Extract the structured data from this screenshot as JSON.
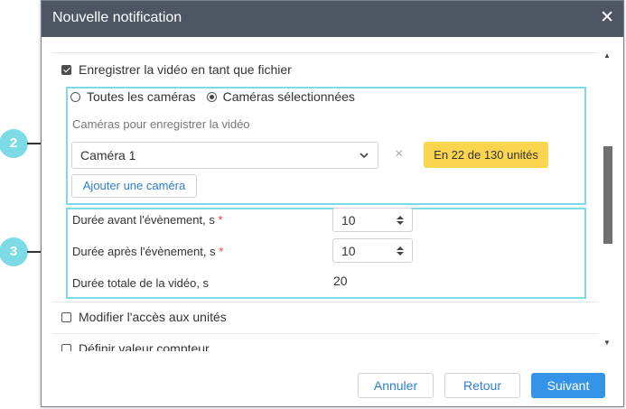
{
  "dialog": {
    "title": "Nouvelle notification",
    "close_glyph": "✕"
  },
  "record_video": {
    "label": "Enregistrer la vidéo en tant que fichier",
    "checked": true
  },
  "camera_mode": {
    "all_label": "Toutes les caméras",
    "selected_label": "Caméras sélectionnées",
    "selected": "selected"
  },
  "cameras": {
    "section_label": "Caméras pour enregistrer la vidéo",
    "selected_value": "Caméra 1",
    "clear_glyph": "×",
    "badge": "En 22 de 130 unités",
    "add_button": "Ajouter une caméra"
  },
  "fields": {
    "before_label": "Durée avant l'évènement, s",
    "before_value": "10",
    "after_label": "Durée après l'évènement, s",
    "after_value": "10",
    "total_label": "Durée totale de la vidéo, s",
    "total_value": "20",
    "required_mark": "*"
  },
  "modify_access": {
    "label": "Modifier l'accès aux unités",
    "checked": false
  },
  "counter": {
    "label": "Définir valeur compteur",
    "checked": false
  },
  "footer": {
    "cancel": "Annuler",
    "back": "Retour",
    "next": "Suivant"
  },
  "callouts": {
    "first": "2",
    "second": "3"
  },
  "colors": {
    "titlebar": "#4e5663",
    "highlight": "#7ddbe6",
    "badge": "#fbd54d",
    "primary": "#3594e8",
    "link": "#2d7fce"
  }
}
